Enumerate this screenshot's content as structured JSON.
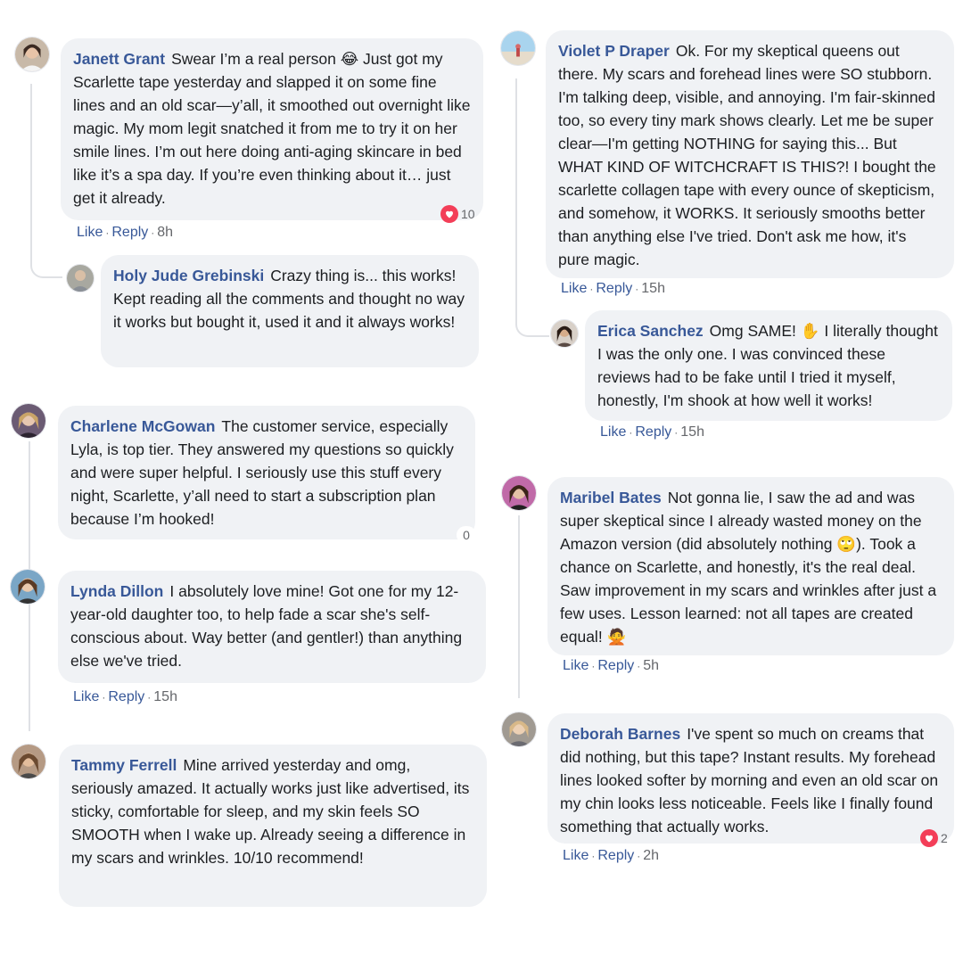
{
  "comments": {
    "janett": {
      "name": "Janett Grant",
      "text": "Swear I’m a real person 😂 Just got my Scarlette tape yesterday and slapped it on some fine lines and an old scar—y’all, it smoothed out overnight like magic. My mom legit snatched it from me to try it on her smile lines. I’m out here doing anti-aging skincare in bed like it’s a spa day. If you’re even thinking about it… just get it already.",
      "reactions": "10",
      "like": "Like",
      "reply": "Reply",
      "time": "8h"
    },
    "holy": {
      "name": "Holy Jude Grebinski",
      "text": "Crazy thing is... this works! Kept reading all the comments and thought no way it works but bought it, used it and it always works!"
    },
    "charlene": {
      "name": "Charlene McGowan",
      "text": "The customer service, especially Lyla, is top tier. They answered my questions so quickly and were super helpful. I seriously use this stuff every night, Scarlette, y’all need to start a subscription plan because I’m hooked!",
      "reactions": "0"
    },
    "lynda": {
      "name": "Lynda Dillon",
      "text": "I absolutely love mine! Got one for my 12-year-old daughter too, to help fade a scar she's self-conscious about. Way better (and gentler!) than anything else we've tried.",
      "like": "Like",
      "reply": "Reply",
      "time": "15h"
    },
    "tammy": {
      "name": "Tammy Ferrell",
      "text": "Mine arrived yesterday and omg, seriously amazed. It actually works just like advertised, its sticky, comfortable for sleep, and my skin feels SO SMOOTH when I wake up. Already seeing a difference in my scars and wrinkles. 10/10 recommend!"
    },
    "violet": {
      "name": "Violet P Draper",
      "text": "Ok. For my skeptical queens out there. My scars and forehead lines were SO stubborn. I'm talking deep, visible, and annoying. I'm fair-skinned too, so every tiny mark shows clearly. Let me be super clear—I'm getting NOTHING for saying this... But WHAT KIND OF WITCHCRAFT IS THIS?! I bought the scarlette collagen tape with every ounce of skepticism, and somehow, it WORKS. It seriously smooths better than anything else I've tried. Don't ask me how, it's pure magic.",
      "like": "Like",
      "reply": "Reply",
      "time": "15h"
    },
    "erica": {
      "name": "Erica Sanchez",
      "text": "Omg SAME! ✋ I literally thought I was the only one. I was convinced these reviews had to be fake until I tried it myself, honestly, I'm shook at how well it works!",
      "like": "Like",
      "reply": "Reply",
      "time": "15h"
    },
    "maribel": {
      "name": "Maribel Bates",
      "text": "Not gonna lie, I saw the ad and was super skeptical since I already wasted money on the Amazon version (did absolutely nothing 🙄). Took a chance on Scarlette, and honestly, it's the real deal. Saw improvement in my scars and wrinkles after just a few uses. Lesson learned: not all tapes are created equal! 🙅",
      "like": "Like",
      "reply": "Reply",
      "time": "5h"
    },
    "deborah": {
      "name": "Deborah Barnes",
      "text": "I've spent so much on creams that did nothing, but this tape? Instant results. My forehead lines looked softer by morning and even an old scar on my chin looks less noticeable. Feels like I finally found something that actually works.",
      "reactions": "2",
      "like": "Like",
      "reply": "Reply",
      "time": "2h"
    }
  },
  "colors": {
    "name": "#385898",
    "bubble": "#f0f2f5",
    "heart": "#f33e58"
  },
  "icons": {
    "reaction": "heart-icon",
    "avatar": "user-avatar-icon"
  }
}
